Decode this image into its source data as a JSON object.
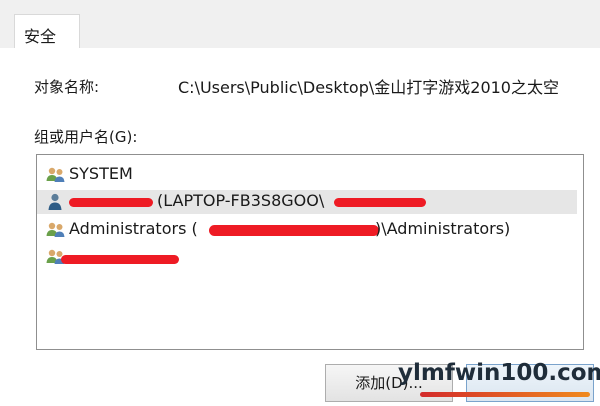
{
  "tabs": [
    {
      "label": "安全"
    }
  ],
  "object": {
    "label": "对象名称:",
    "value": "C:\\Users\\Public\\Desktop\\金山打字游戏2010之太空"
  },
  "groups": {
    "label": "组或用户名(G):",
    "items": [
      {
        "text": "SYSTEM",
        "icon": "group-users-icon"
      },
      {
        "text": "(LAPTOP-FB3S8GOO\\",
        "icon": "user-icon",
        "selected": true
      },
      {
        "text": "Administrators (",
        "tail": ")\\Administrators)",
        "icon": "group-users-icon"
      },
      {
        "text": "",
        "icon": "group-users-icon"
      }
    ]
  },
  "buttons": {
    "add": "添加(D)...",
    "remove": ""
  },
  "watermark": {
    "text": "ylmfwin100.com"
  },
  "colors": {
    "redaction": "#ee1b24",
    "selection": "#e6e6e6",
    "border": "#8f8f8f"
  }
}
